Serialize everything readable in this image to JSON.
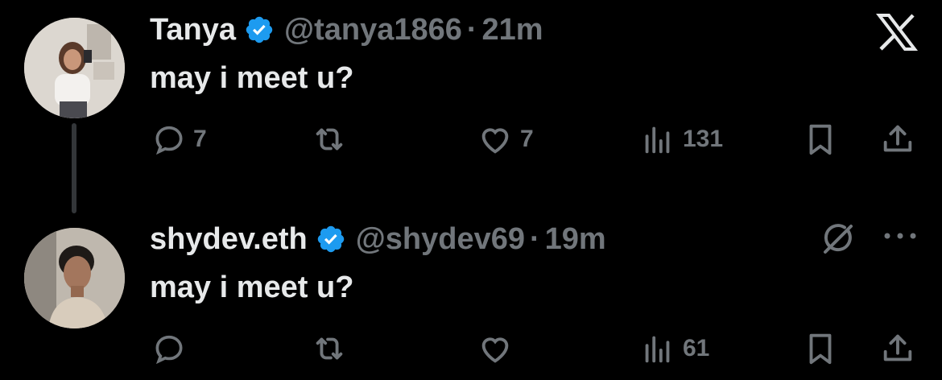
{
  "colors": {
    "background": "#000000",
    "text_primary": "#e7e9ea",
    "text_secondary": "#71767b",
    "verified_blue": "#1d9bf0",
    "thread_line": "#333639"
  },
  "app": {
    "logo_icon": "x-logo-icon"
  },
  "tweets": [
    {
      "author_name": "Tanya",
      "handle": "@tanya1866",
      "separator": "·",
      "time": "21m",
      "text": "may i meet u?",
      "replies": "7",
      "reposts": "",
      "likes": "7",
      "views": "131"
    },
    {
      "author_name": "shydev.eth",
      "handle": "@shydev69",
      "separator": "·",
      "time": "19m",
      "text": "may i meet u?",
      "replies": "",
      "reposts": "",
      "likes": "",
      "views": "61"
    }
  ]
}
